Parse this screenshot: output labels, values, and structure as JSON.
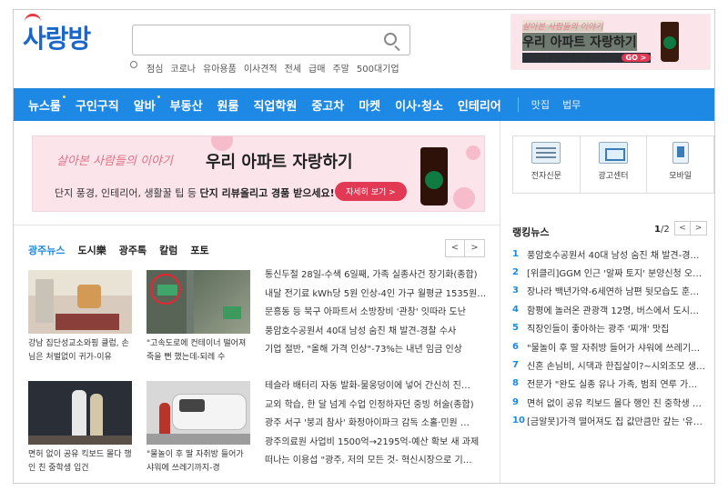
{
  "header": {
    "logo": "사랑방",
    "search_placeholder": "",
    "hot_keywords": [
      "점심",
      "코로나",
      "유아용품",
      "이사견적",
      "전세",
      "급매",
      "주말",
      "500대기업"
    ]
  },
  "top_ad": {
    "line1": "살아본 사람들의 이야기",
    "line2": "우리 아파트 자랑하기",
    "line3": "단지리뷰 올리고 경품 받으세요!",
    "go": "GO >"
  },
  "nav": {
    "items": [
      "뉴스룸",
      "구인구직",
      "알바",
      "부동산",
      "원룸",
      "직업학원",
      "중고차",
      "마켓",
      "이사·청소",
      "인테리어"
    ],
    "sub_items": [
      "맛집",
      "법무"
    ]
  },
  "banner": {
    "script": "살아본 사람들의 이야기",
    "title": "우리 아파트 자랑하기",
    "desc_plain": "단지 풍경, 인테리어, 생활꿀 팁 등 ",
    "desc_bold": "단지 리뷰올리고 경품 받으세요!",
    "cta": "자세히 보기 >"
  },
  "services": [
    {
      "label": "전자신문",
      "icon": "newspaper-icon"
    },
    {
      "label": "광고센터",
      "icon": "monitor-icon"
    },
    {
      "label": "모바일",
      "icon": "mobile-icon"
    }
  ],
  "tabs": [
    "광주뉴스",
    "도시樂",
    "광주톡",
    "칼럼",
    "포토"
  ],
  "pager": {
    "prev": "<",
    "next": ">"
  },
  "thumbs": [
    {
      "caption": "강남 집단성교소와핑 클럽, 손님은 처벌없이 귀가-이유"
    },
    {
      "caption": "\"고속도로에 컨테이너 떨어져 죽을 뻔 했는데-되레 수"
    },
    {
      "caption": "면허 없이 공유 킥보드 몰다 행인 친 중학생 입건"
    },
    {
      "caption": "\"물놀이 후 딸 자취방 들어가 샤워에 쓰레기까지-경"
    }
  ],
  "headlines_top": [
    "통신두절 28일-수색 6일째, 가족 실종사건 장기화(종합)",
    "내달 전기료 kWh당 5원 인상-4인 가구 월평균 1535원…",
    "문흥동 등 북구 아파트서 소방장비 '관창' 잇따라 도난",
    "풍암호수공원서 40대 남성 숨진 채 발견-경찰 수사",
    "기업 절반, \"올해 가격 인상\"-73%는 내년 임금 인상"
  ],
  "headlines_bottom": [
    "테슬라 배터리 자동 발화-물웅덩이에 넣어 간신히 진…",
    "교외 학습, 한 달 넘게 수업 인정하자던 중빙 허술(종합)",
    "광주 서구 '붕괴 참사' 화정아이파크 감독 소홀·민원 …",
    "광주의료원 사업비 1500억→2195억-예산 확보 새 과제",
    "떠나는 이용섭 \"광주, 저의 모든 것- 혁신시장으로 기…"
  ],
  "ranking": {
    "title": "랭킹뉴스",
    "page_current": "1",
    "page_total": "/2",
    "items": [
      {
        "num": "1",
        "text": "풍암호수공원서 40대 남성 숨진 채 발견-경…"
      },
      {
        "num": "2",
        "text": "[위클리]GGM 인근 '알짜 토지' 분양신청 오…"
      },
      {
        "num": "3",
        "text": "장나라 백년가약-6세연하 남편 뒷모습도 훈…"
      },
      {
        "num": "4",
        "text": "함평에 놀러온 관광객 12명, 버스에서 도시…"
      },
      {
        "num": "5",
        "text": "직장인들이 좋아하는 광주 '찌개' 맛집"
      },
      {
        "num": "6",
        "text": "\"물놀이 후 딸 자취방 들어가 샤워에 쓰레기…"
      },
      {
        "num": "7",
        "text": "신혼 손님비, 시댁과 한집살이?~시외조모 생…"
      },
      {
        "num": "8",
        "text": "전문가 \"완도 실종 유나 가족, 범죄 연루 가…"
      },
      {
        "num": "9",
        "text": "면허 없이 공유 킥보드 몰다 행인 친 중학생 …"
      },
      {
        "num": "10",
        "text": "[금알못]가격 떨어져도 집 값만큼만 갚는 '유…"
      }
    ]
  },
  "colors": {
    "brand": "#1e88e5",
    "accent": "#e23a55",
    "logo": "#1a66c9"
  }
}
